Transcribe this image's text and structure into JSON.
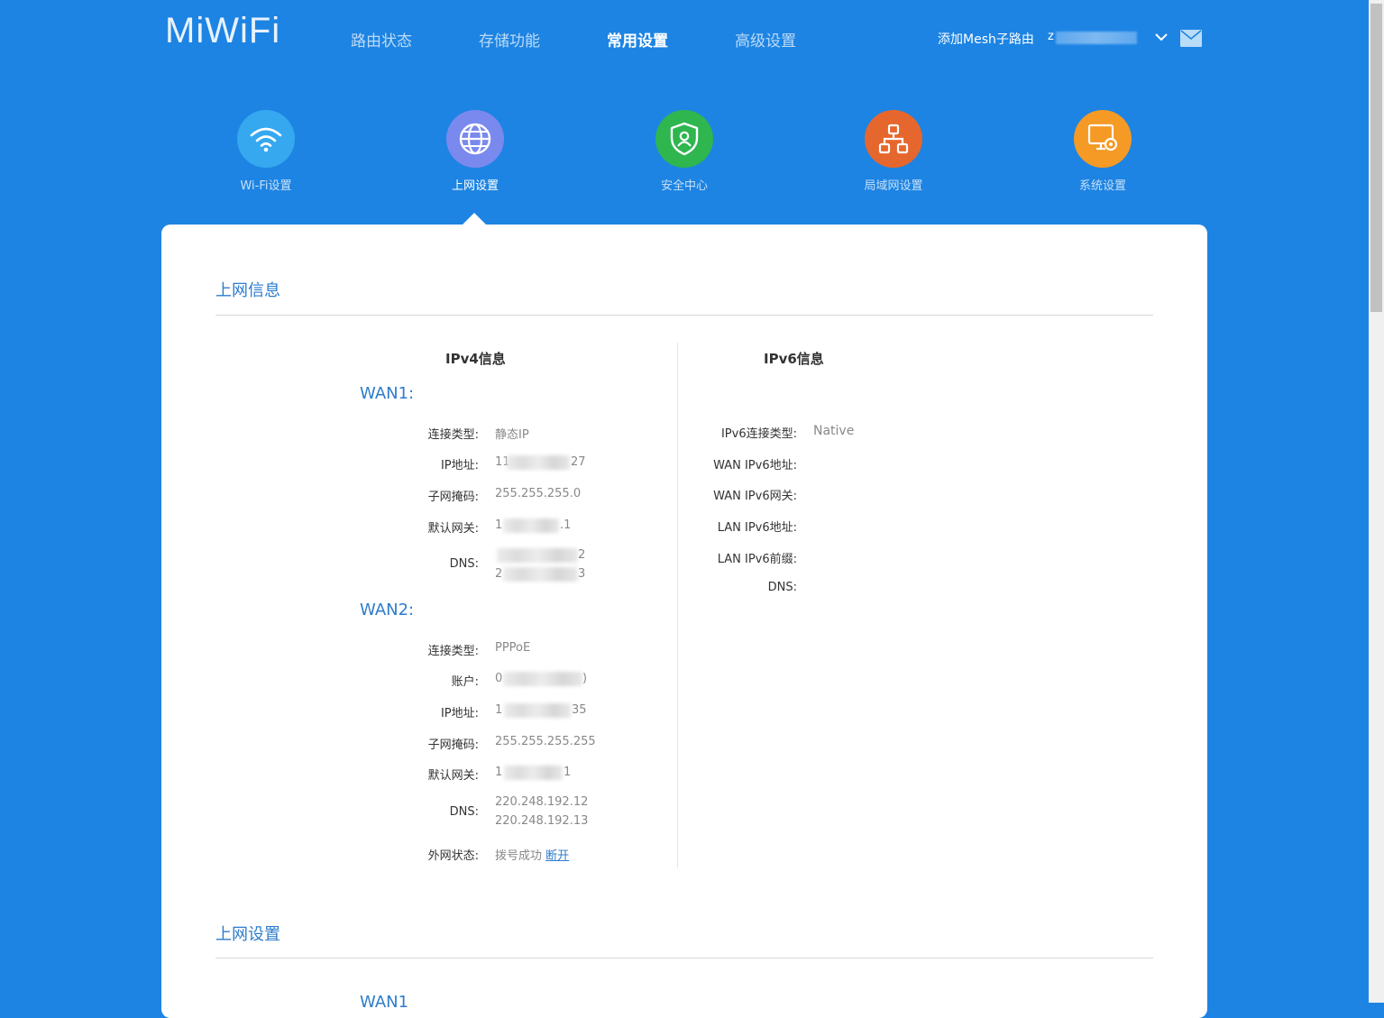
{
  "logo": "MiWiFi",
  "nav": {
    "items": [
      "路由状态",
      "存储功能",
      "常用设置",
      "高级设置"
    ],
    "active_index": 2
  },
  "header": {
    "mesh_link": "添加Mesh子路由",
    "device_name": "z",
    "icons": [
      "chevron-down-icon",
      "mail-icon"
    ]
  },
  "quick_nav": {
    "items": [
      {
        "label": "Wi-Fi设置",
        "icon": "wifi-icon",
        "color": "#35a8f0"
      },
      {
        "label": "上网设置",
        "icon": "globe-icon",
        "color": "#7a89ee"
      },
      {
        "label": "安全中心",
        "icon": "shield-icon",
        "color": "#2fb64f"
      },
      {
        "label": "局域网设置",
        "icon": "lan-network-icon",
        "color": "#e6672d"
      },
      {
        "label": "系统设置",
        "icon": "system-settings-icon",
        "color": "#f49a25"
      }
    ],
    "active_index": 1
  },
  "section_info": {
    "title": "上网信息",
    "ipv4": {
      "title": "IPv4信息",
      "wan1": {
        "title": "WAN1:",
        "fields": [
          {
            "label": "连接类型:",
            "value": "静态IP"
          },
          {
            "label": "IP地址:",
            "value": "11",
            "value_end": "27"
          },
          {
            "label": "子网掩码:",
            "value": "255.255.255.0"
          },
          {
            "label": "默认网关:",
            "value": "1",
            "value_end": ".1"
          },
          {
            "label": "DNS:",
            "value": "",
            "value_end": "2",
            "value2": "2",
            "value2_end": "3"
          }
        ]
      },
      "wan2": {
        "title": "WAN2:",
        "fields": [
          {
            "label": "连接类型:",
            "value": "PPPoE"
          },
          {
            "label": "账户:",
            "value": "0",
            "value_end": ")"
          },
          {
            "label": "IP地址:",
            "value": "1",
            "value_end": "35"
          },
          {
            "label": "子网掩码:",
            "value": "255.255.255.255"
          },
          {
            "label": "默认网关:",
            "value": "1",
            "value_end": "1"
          },
          {
            "label": "DNS:",
            "value": "220.248.192.12",
            "value2": "220.248.192.13"
          },
          {
            "label": "外网状态:",
            "value": "拨号成功",
            "link": "断开"
          }
        ]
      }
    },
    "ipv6": {
      "title": "IPv6信息",
      "fields": [
        {
          "label": "IPv6连接类型:",
          "value": "Native"
        },
        {
          "label": "WAN IPv6地址:",
          "value": ""
        },
        {
          "label": "WAN IPv6网关:",
          "value": ""
        },
        {
          "label": "LAN IPv6地址:",
          "value": ""
        },
        {
          "label": "LAN IPv6前缀:",
          "value": ""
        },
        {
          "label": "DNS:",
          "value": ""
        }
      ]
    }
  },
  "section_settings": {
    "title": "上网设置",
    "wan_partial": "WAN1"
  }
}
